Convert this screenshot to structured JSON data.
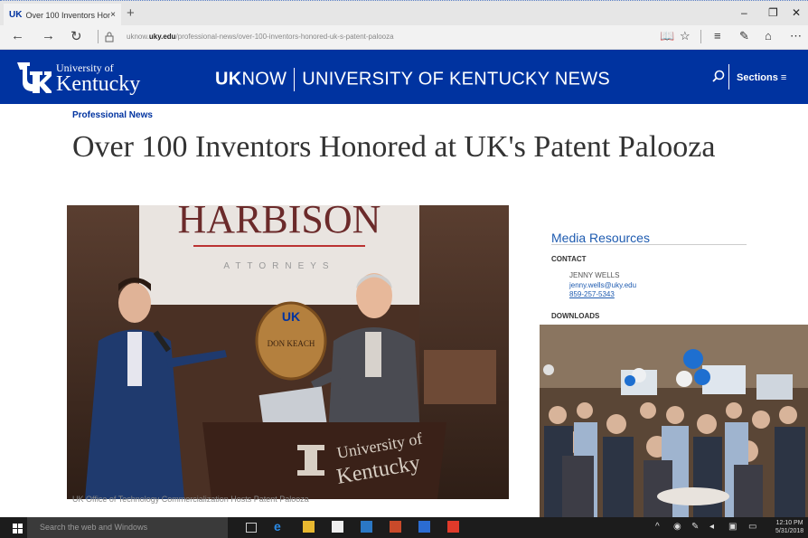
{
  "browser": {
    "tab_title": "Over 100 Inventors Hono",
    "tab_close": "×",
    "new_tab": "+",
    "url_prefix": "uknow.",
    "url_domain": "uky.edu",
    "url_path": "/professional-news/over-100-inventors-honored-uk-s-patent-palooza",
    "icons": [
      "back-icon",
      "forward-icon",
      "refresh-icon",
      "lock-icon",
      "reading-view-icon",
      "favorite-star-icon",
      "hub-icon",
      "web-note-icon",
      "share-icon",
      "more-icon"
    ]
  },
  "site": {
    "university_line1": "University of",
    "university_line2": "Kentucky",
    "brand_bold": "UK",
    "brand_rest": "NOW",
    "brand_tagline": "UNIVERSITY OF KENTUCKY NEWS",
    "sections_label": "Sections ≡",
    "colors": {
      "uk_blue": "#0033a0",
      "link_blue": "#1e5bb0"
    }
  },
  "article": {
    "section": "Professional News",
    "headline": "Over 100 Inventors Honored at UK's Patent Palooza",
    "caption": "UK Office of Technology Commercialization Hosts Patent Palooza",
    "photo1": {
      "banner_text": "HARBISON",
      "banner_sub": "ATTORNEYS",
      "plaque_text": "DON KEACH",
      "podium_line1": "University of",
      "podium_line2": "Kentucky"
    }
  },
  "sidebar": {
    "title": "Media Resources",
    "contact_label": "CONTACT",
    "contact_name": "JENNY WELLS",
    "contact_email": "jenny.wells@uky.edu",
    "contact_phone": "859-257-5343",
    "downloads_label": "DOWNLOADS"
  },
  "taskbar": {
    "search_placeholder": "Search the web and Windows",
    "time": "12:10 PM",
    "date": "5/31/2018"
  }
}
